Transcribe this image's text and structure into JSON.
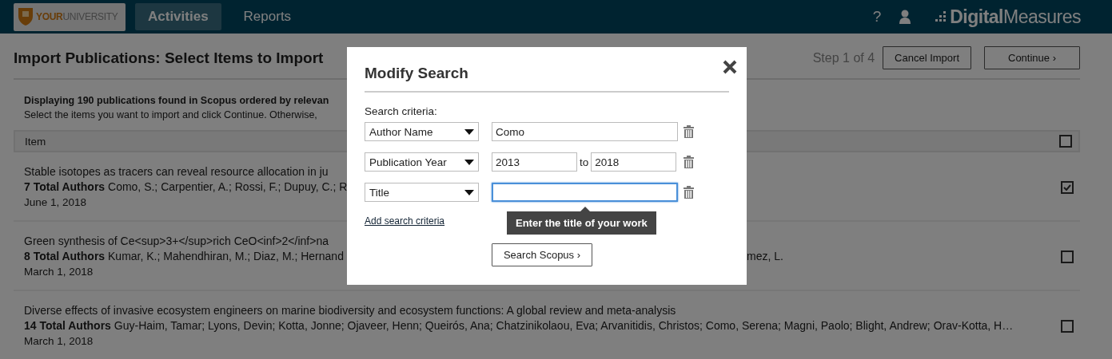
{
  "header": {
    "logo": "**YOUR**UNIVERSITY",
    "tabs": [
      {
        "label": "Activities",
        "selected": true
      },
      {
        "label": "Reports",
        "selected": false
      }
    ],
    "help": "?",
    "brand": "**Digital**Measures"
  },
  "page": {
    "title": "Import Publications: Select Items to Import",
    "step": "Step 1 of 4",
    "buttons": [
      "Cancel Import",
      "Continue ›"
    ]
  },
  "intro": {
    "summary": "Displaying 190 publications found in Scopus ordered by relevan",
    "instruction": "Select the items you want to import and click Continue. Otherwise,"
  },
  "table": {
    "header": {
      "label": "Item",
      "checked": false
    },
    "rows": [
      {
        "title": "Stable isotopes as tracers can reveal resource allocation in ju",
        "authors": "**7 Total Authors** Como, S.; Carpentier, A.; Rossi, F.; Dupuy, C.; R",
        "date": "June 1, 2018",
        "checked": true
      },
      {
        "title": "Green synthesis of Ce<sup>3+</sup>rich CeO<inf>2</inf>na",
        "authors": "**8 Total Authors** Kumar, K.; Mahendhiran, M.; Diaz, M.; Hernand",
        "authors_right": "mez, L.",
        "date": "March 1, 2018",
        "checked": false
      },
      {
        "title": "Diverse effects of invasive ecosystem engineers on marine biodiversity and ecosystem functions: A global review and meta-analysis",
        "authors": "**14 Total Authors** Guy-Haim, Tamar; Lyons, Devin; Kotta, Jonne; Ojaveer, Henn; Queirós, Ana; Chatzinikolaou, Eva; Arvanitidis, Christos; Como, Serena; Magni, Paolo; Blight, Andrew; Orav-Kotta, H…",
        "date": "March 1, 2018",
        "checked": false
      }
    ]
  },
  "dialog": {
    "title": "Modify Search",
    "label": "Search criteria:",
    "criteria": [
      {
        "kind": "text",
        "field": "Author Name",
        "value": "Como",
        "focused": false
      },
      {
        "kind": "range",
        "field": "Publication Year",
        "from": "2013",
        "separator": "to",
        "to": "2018"
      },
      {
        "kind": "text",
        "field": "Title",
        "focused": true,
        "tooltip": "Enter the title of your work"
      }
    ],
    "add_link": "Add search criteria",
    "submit": "Search Scopus ›"
  }
}
